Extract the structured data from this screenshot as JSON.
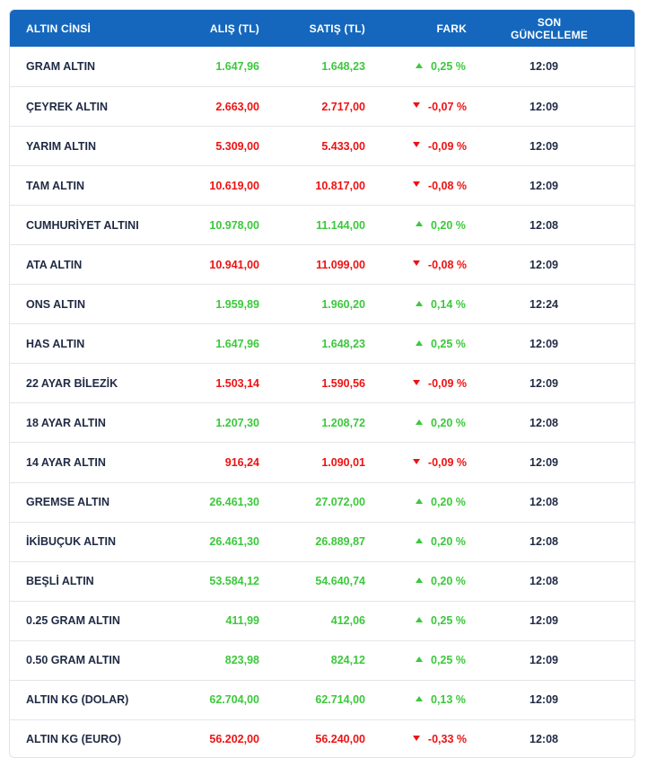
{
  "header": {
    "name": "ALTIN CİNSİ",
    "buy": "ALIŞ (TL)",
    "sell": "SATIŞ (TL)",
    "diff": "FARK",
    "time": "SON GÜNCELLEME"
  },
  "colors": {
    "header_bg": "#1467bd",
    "up": "#3cc83c",
    "down": "#ee1212"
  },
  "rows": [
    {
      "name": "GRAM ALTIN",
      "buy": "1.647,96",
      "sell": "1.648,23",
      "diff": "0,25 %",
      "dir": "up",
      "time": "12:09"
    },
    {
      "name": "ÇEYREK ALTIN",
      "buy": "2.663,00",
      "sell": "2.717,00",
      "diff": "-0,07 %",
      "dir": "down",
      "time": "12:09"
    },
    {
      "name": "YARIM ALTIN",
      "buy": "5.309,00",
      "sell": "5.433,00",
      "diff": "-0,09 %",
      "dir": "down",
      "time": "12:09"
    },
    {
      "name": "TAM ALTIN",
      "buy": "10.619,00",
      "sell": "10.817,00",
      "diff": "-0,08 %",
      "dir": "down",
      "time": "12:09"
    },
    {
      "name": "CUMHURİYET ALTINI",
      "buy": "10.978,00",
      "sell": "11.144,00",
      "diff": "0,20 %",
      "dir": "up",
      "time": "12:08"
    },
    {
      "name": "ATA ALTIN",
      "buy": "10.941,00",
      "sell": "11.099,00",
      "diff": "-0,08 %",
      "dir": "down",
      "time": "12:09"
    },
    {
      "name": "ONS ALTIN",
      "buy": "1.959,89",
      "sell": "1.960,20",
      "diff": "0,14 %",
      "dir": "up",
      "time": "12:24"
    },
    {
      "name": "HAS ALTIN",
      "buy": "1.647,96",
      "sell": "1.648,23",
      "diff": "0,25 %",
      "dir": "up",
      "time": "12:09"
    },
    {
      "name": "22 AYAR BİLEZİK",
      "buy": "1.503,14",
      "sell": "1.590,56",
      "diff": "-0,09 %",
      "dir": "down",
      "time": "12:09"
    },
    {
      "name": "18 AYAR ALTIN",
      "buy": "1.207,30",
      "sell": "1.208,72",
      "diff": "0,20 %",
      "dir": "up",
      "time": "12:08"
    },
    {
      "name": "14 AYAR ALTIN",
      "buy": "916,24",
      "sell": "1.090,01",
      "diff": "-0,09 %",
      "dir": "down",
      "time": "12:09"
    },
    {
      "name": "GREMSE ALTIN",
      "buy": "26.461,30",
      "sell": "27.072,00",
      "diff": "0,20 %",
      "dir": "up",
      "time": "12:08"
    },
    {
      "name": "İKİBUÇUK ALTIN",
      "buy": "26.461,30",
      "sell": "26.889,87",
      "diff": "0,20 %",
      "dir": "up",
      "time": "12:08"
    },
    {
      "name": "BEŞLİ ALTIN",
      "buy": "53.584,12",
      "sell": "54.640,74",
      "diff": "0,20 %",
      "dir": "up",
      "time": "12:08"
    },
    {
      "name": "0.25 GRAM ALTIN",
      "buy": "411,99",
      "sell": "412,06",
      "diff": "0,25 %",
      "dir": "up",
      "time": "12:09"
    },
    {
      "name": "0.50 GRAM ALTIN",
      "buy": "823,98",
      "sell": "824,12",
      "diff": "0,25 %",
      "dir": "up",
      "time": "12:09"
    },
    {
      "name": "ALTIN KG (DOLAR)",
      "buy": "62.704,00",
      "sell": "62.714,00",
      "diff": "0,13 %",
      "dir": "up",
      "time": "12:09"
    },
    {
      "name": "ALTIN KG (EURO)",
      "buy": "56.202,00",
      "sell": "56.240,00",
      "diff": "-0,33 %",
      "dir": "down",
      "time": "12:08"
    }
  ]
}
